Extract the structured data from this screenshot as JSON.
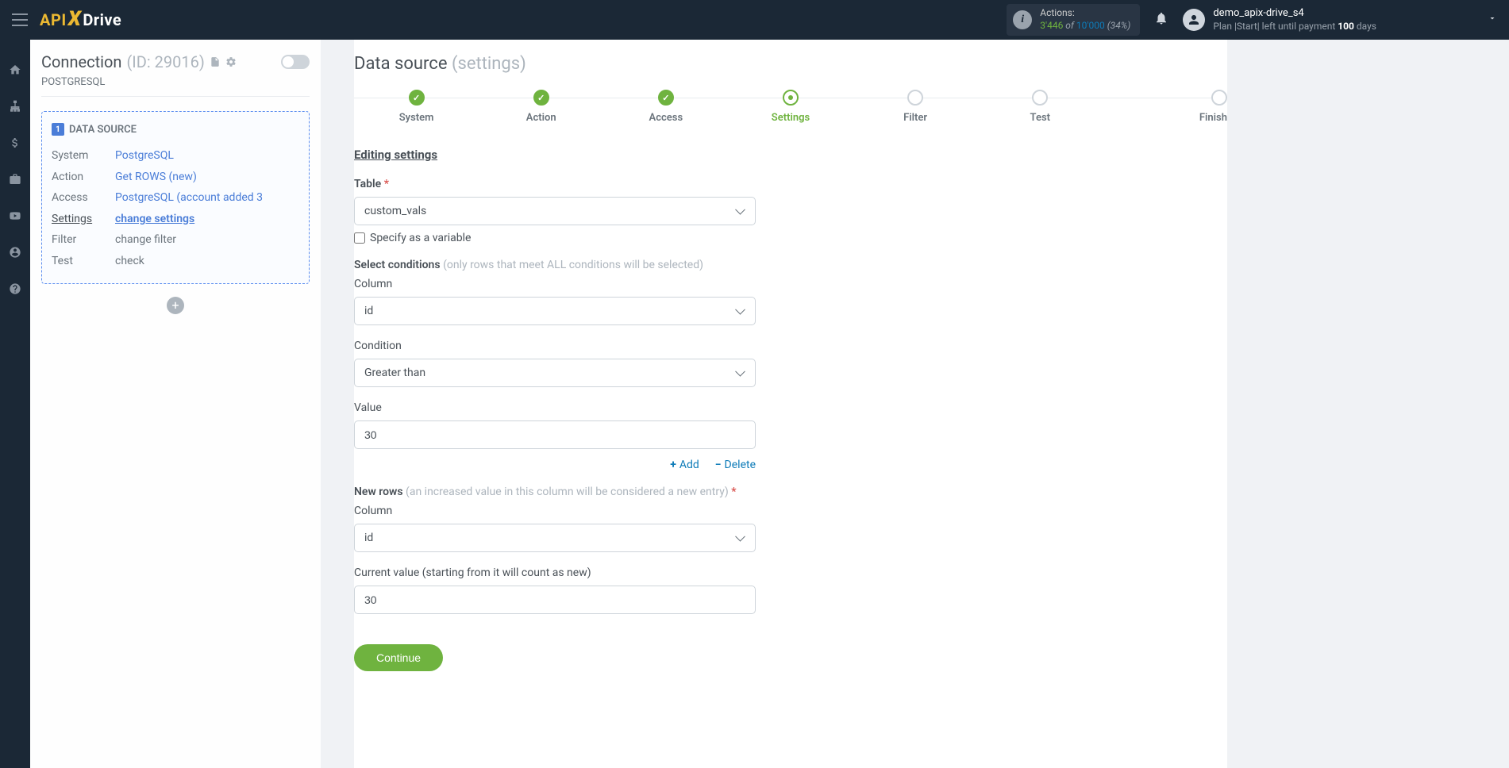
{
  "header": {
    "logo": {
      "part1": "API",
      "part2": "X",
      "part3": "Drive"
    },
    "actions": {
      "label": "Actions:",
      "used": "3'446",
      "of": " of ",
      "total": "10'000",
      "pct": " (34%)"
    },
    "user": {
      "name": "demo_apix-drive_s4",
      "plan_prefix": "Plan |Start| left until payment ",
      "plan_days": "100",
      "plan_suffix": " days"
    }
  },
  "left": {
    "title": "Connection",
    "id": "(ID: 29016)",
    "subtitle": "POSTGRESQL",
    "card": {
      "badge": "1",
      "header": "DATA SOURCE",
      "rows": {
        "system": {
          "k": "System",
          "v": "PostgreSQL"
        },
        "action": {
          "k": "Action",
          "v": "Get ROWS (new)"
        },
        "access": {
          "k": "Access",
          "v": "PostgreSQL (account added 3"
        },
        "settings": {
          "k": "Settings",
          "v": "change settings"
        },
        "filter": {
          "k": "Filter",
          "v": "change filter"
        },
        "test": {
          "k": "Test",
          "v": "check"
        }
      }
    }
  },
  "main": {
    "title": "Data source",
    "subtitle": "(settings)",
    "steps": [
      "System",
      "Action",
      "Access",
      "Settings",
      "Filter",
      "Test",
      "Finish"
    ],
    "section": "Editing settings",
    "form": {
      "table_label": "Table",
      "table_value": "custom_vals",
      "specify_var": "Specify as a variable",
      "select_cond_label": "Select conditions",
      "select_cond_hint": "(only rows that meet ALL conditions will be selected)",
      "column_label": "Column",
      "column_value": "id",
      "condition_label": "Condition",
      "condition_value": "Greater than",
      "value_label": "Value",
      "value_value": "30",
      "add": "Add",
      "delete": "Delete",
      "newrows_label": "New rows",
      "newrows_hint": "(an increased value in this column will be considered a new entry)",
      "newrows_column_label": "Column",
      "newrows_column_value": "id",
      "current_label": "Current value (starting from it will count as new)",
      "current_value": "30",
      "continue": "Continue"
    }
  }
}
